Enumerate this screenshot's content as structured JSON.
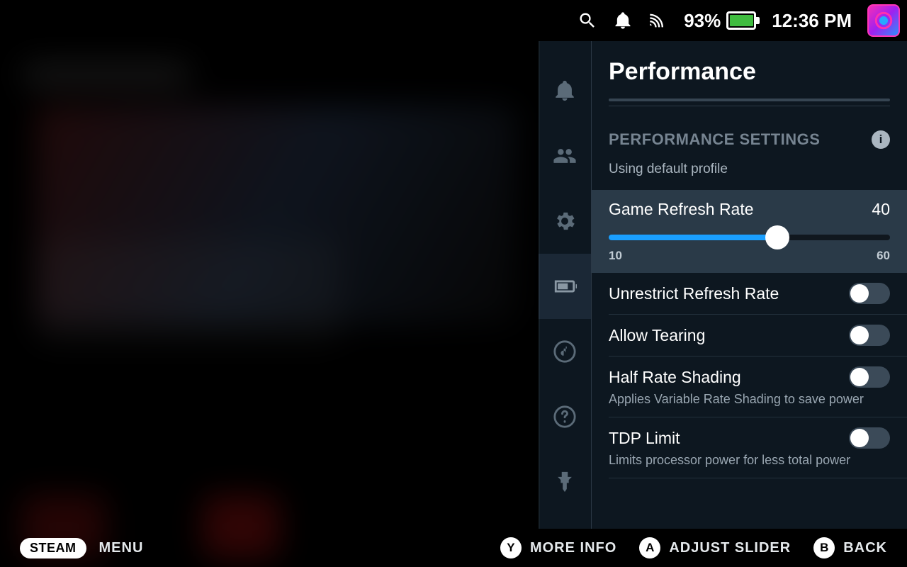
{
  "status_bar": {
    "battery_percent": "93%",
    "clock": "12:36 PM"
  },
  "panel": {
    "title": "Performance",
    "section_header": "PERFORMANCE SETTINGS",
    "profile_note": "Using default profile",
    "slider": {
      "label": "Game Refresh Rate",
      "value": "40",
      "min": "10",
      "max": "60",
      "min_num": 10,
      "max_num": 60,
      "val_num": 40
    },
    "toggles": [
      {
        "label": "Unrestrict Refresh Rate",
        "description": "",
        "on": false
      },
      {
        "label": "Allow Tearing",
        "description": "",
        "on": false
      },
      {
        "label": "Half Rate Shading",
        "description": "Applies Variable Rate Shading to save power",
        "on": false
      },
      {
        "label": "TDP Limit",
        "description": "Limits processor power for less total power",
        "on": false
      }
    ]
  },
  "footer": {
    "steam": "STEAM",
    "menu": "MENU",
    "hints": [
      {
        "button": "Y",
        "label": "MORE INFO"
      },
      {
        "button": "A",
        "label": "ADJUST SLIDER"
      },
      {
        "button": "B",
        "label": "BACK"
      }
    ]
  }
}
